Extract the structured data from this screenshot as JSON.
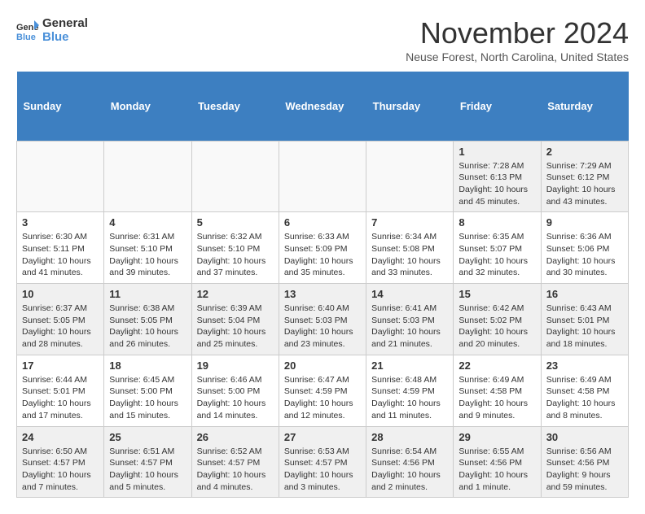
{
  "logo": {
    "line1": "General",
    "line2": "Blue"
  },
  "title": "November 2024",
  "location": "Neuse Forest, North Carolina, United States",
  "days_of_week": [
    "Sunday",
    "Monday",
    "Tuesday",
    "Wednesday",
    "Thursday",
    "Friday",
    "Saturday"
  ],
  "weeks": [
    [
      {
        "day": "",
        "info": ""
      },
      {
        "day": "",
        "info": ""
      },
      {
        "day": "",
        "info": ""
      },
      {
        "day": "",
        "info": ""
      },
      {
        "day": "",
        "info": ""
      },
      {
        "day": "1",
        "info": "Sunrise: 7:28 AM\nSunset: 6:13 PM\nDaylight: 10 hours and 45 minutes."
      },
      {
        "day": "2",
        "info": "Sunrise: 7:29 AM\nSunset: 6:12 PM\nDaylight: 10 hours and 43 minutes."
      }
    ],
    [
      {
        "day": "3",
        "info": "Sunrise: 6:30 AM\nSunset: 5:11 PM\nDaylight: 10 hours and 41 minutes."
      },
      {
        "day": "4",
        "info": "Sunrise: 6:31 AM\nSunset: 5:10 PM\nDaylight: 10 hours and 39 minutes."
      },
      {
        "day": "5",
        "info": "Sunrise: 6:32 AM\nSunset: 5:10 PM\nDaylight: 10 hours and 37 minutes."
      },
      {
        "day": "6",
        "info": "Sunrise: 6:33 AM\nSunset: 5:09 PM\nDaylight: 10 hours and 35 minutes."
      },
      {
        "day": "7",
        "info": "Sunrise: 6:34 AM\nSunset: 5:08 PM\nDaylight: 10 hours and 33 minutes."
      },
      {
        "day": "8",
        "info": "Sunrise: 6:35 AM\nSunset: 5:07 PM\nDaylight: 10 hours and 32 minutes."
      },
      {
        "day": "9",
        "info": "Sunrise: 6:36 AM\nSunset: 5:06 PM\nDaylight: 10 hours and 30 minutes."
      }
    ],
    [
      {
        "day": "10",
        "info": "Sunrise: 6:37 AM\nSunset: 5:05 PM\nDaylight: 10 hours and 28 minutes."
      },
      {
        "day": "11",
        "info": "Sunrise: 6:38 AM\nSunset: 5:05 PM\nDaylight: 10 hours and 26 minutes."
      },
      {
        "day": "12",
        "info": "Sunrise: 6:39 AM\nSunset: 5:04 PM\nDaylight: 10 hours and 25 minutes."
      },
      {
        "day": "13",
        "info": "Sunrise: 6:40 AM\nSunset: 5:03 PM\nDaylight: 10 hours and 23 minutes."
      },
      {
        "day": "14",
        "info": "Sunrise: 6:41 AM\nSunset: 5:03 PM\nDaylight: 10 hours and 21 minutes."
      },
      {
        "day": "15",
        "info": "Sunrise: 6:42 AM\nSunset: 5:02 PM\nDaylight: 10 hours and 20 minutes."
      },
      {
        "day": "16",
        "info": "Sunrise: 6:43 AM\nSunset: 5:01 PM\nDaylight: 10 hours and 18 minutes."
      }
    ],
    [
      {
        "day": "17",
        "info": "Sunrise: 6:44 AM\nSunset: 5:01 PM\nDaylight: 10 hours and 17 minutes."
      },
      {
        "day": "18",
        "info": "Sunrise: 6:45 AM\nSunset: 5:00 PM\nDaylight: 10 hours and 15 minutes."
      },
      {
        "day": "19",
        "info": "Sunrise: 6:46 AM\nSunset: 5:00 PM\nDaylight: 10 hours and 14 minutes."
      },
      {
        "day": "20",
        "info": "Sunrise: 6:47 AM\nSunset: 4:59 PM\nDaylight: 10 hours and 12 minutes."
      },
      {
        "day": "21",
        "info": "Sunrise: 6:48 AM\nSunset: 4:59 PM\nDaylight: 10 hours and 11 minutes."
      },
      {
        "day": "22",
        "info": "Sunrise: 6:49 AM\nSunset: 4:58 PM\nDaylight: 10 hours and 9 minutes."
      },
      {
        "day": "23",
        "info": "Sunrise: 6:49 AM\nSunset: 4:58 PM\nDaylight: 10 hours and 8 minutes."
      }
    ],
    [
      {
        "day": "24",
        "info": "Sunrise: 6:50 AM\nSunset: 4:57 PM\nDaylight: 10 hours and 7 minutes."
      },
      {
        "day": "25",
        "info": "Sunrise: 6:51 AM\nSunset: 4:57 PM\nDaylight: 10 hours and 5 minutes."
      },
      {
        "day": "26",
        "info": "Sunrise: 6:52 AM\nSunset: 4:57 PM\nDaylight: 10 hours and 4 minutes."
      },
      {
        "day": "27",
        "info": "Sunrise: 6:53 AM\nSunset: 4:57 PM\nDaylight: 10 hours and 3 minutes."
      },
      {
        "day": "28",
        "info": "Sunrise: 6:54 AM\nSunset: 4:56 PM\nDaylight: 10 hours and 2 minutes."
      },
      {
        "day": "29",
        "info": "Sunrise: 6:55 AM\nSunset: 4:56 PM\nDaylight: 10 hours and 1 minute."
      },
      {
        "day": "30",
        "info": "Sunrise: 6:56 AM\nSunset: 4:56 PM\nDaylight: 9 hours and 59 minutes."
      }
    ]
  ]
}
